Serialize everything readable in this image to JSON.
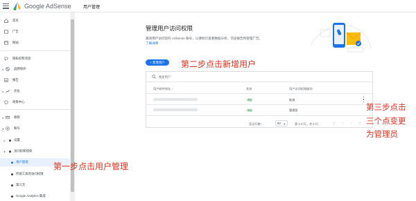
{
  "app": {
    "brand": "Google AdSense",
    "breadcrumb": "用户管理"
  },
  "sidebar": {
    "items": [
      {
        "label": "首页",
        "icon": "home-icon"
      },
      {
        "label": "广告",
        "icon": "ads-icon"
      },
      {
        "label": "网站",
        "icon": "sites-icon"
      },
      {
        "label": "隐私权和消息",
        "icon": "privacy-icon"
      },
      {
        "label": "品牌保护",
        "icon": "block-icon"
      },
      {
        "label": "报告",
        "icon": "reports-icon"
      },
      {
        "label": "优化",
        "icon": "optimize-icon"
      },
      {
        "label": "政策中心",
        "icon": "policy-icon"
      },
      {
        "label": "收款",
        "icon": "payments-icon"
      },
      {
        "label": "账号",
        "icon": "account-icon"
      },
      {
        "label": "设置"
      },
      {
        "label": "访问权和授权"
      },
      {
        "label": "用户管理"
      },
      {
        "label": "所链工具的访问权限"
      },
      {
        "label": "第三方"
      },
      {
        "label": "Google Analytics 集成"
      }
    ]
  },
  "main": {
    "title": "管理用户访问权限",
    "description": "邀请用户访问您的 AdSense 账号，以便他们查看数据分析，浏览报告和管理广告。",
    "learn_more": "了解详情",
    "add_user_button": "+ 新增用户",
    "search_placeholder": "搜索用户",
    "table": {
      "columns": [
        "用户邮件地址",
        "状态",
        "用户访问权限级别"
      ],
      "rows": [
        {
          "status": "有效",
          "role": "标准"
        },
        {
          "status": "有效",
          "role": "管理员"
        }
      ]
    },
    "pagination": {
      "rows_per_page_label": "显示行数：",
      "rows_per_page": "50",
      "range": "第 1-2 行，共 2 行"
    }
  },
  "annotations": {
    "step1": "第一步点击用户管理",
    "step2": "第二步点击新增用户",
    "step3": "第三步点击三个点变更为管理员"
  },
  "colors": {
    "accent": "#1a73e8",
    "annotation": "#e0301e",
    "active_bg": "#e8f0fe",
    "badge_bg": "#e6f4ea",
    "badge_text": "#137333"
  }
}
